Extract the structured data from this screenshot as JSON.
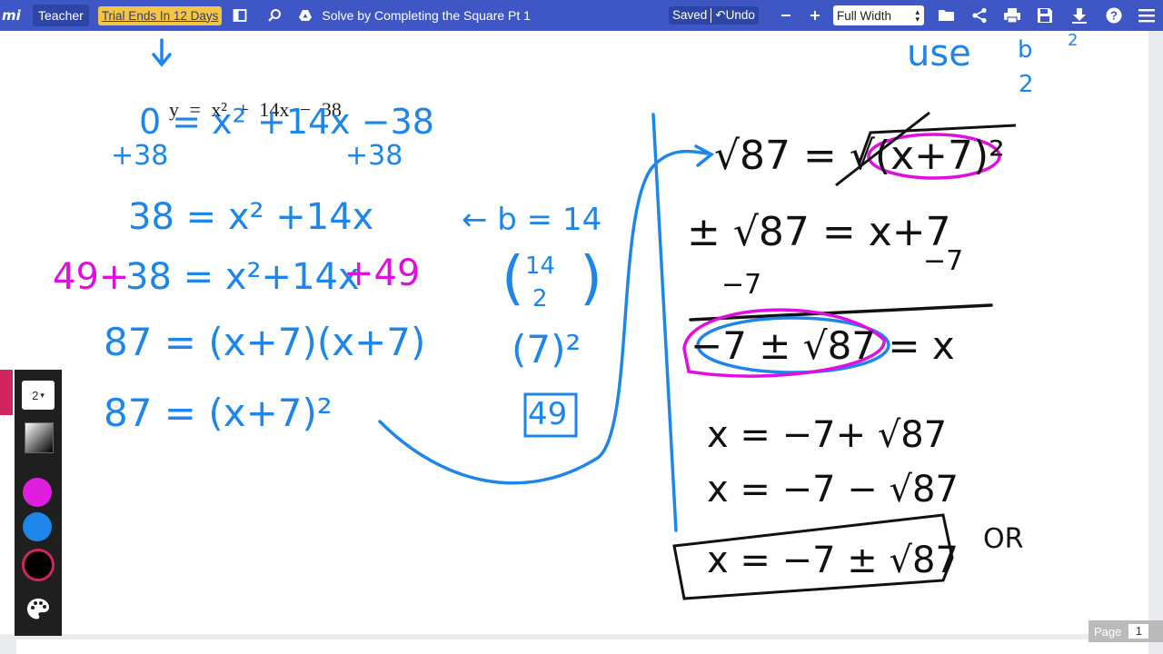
{
  "topbar": {
    "logo": "mi",
    "role": "Teacher",
    "trial": "Trial Ends In 12 Days",
    "title": "Solve by Completing the Square Pt 1",
    "saved": "Saved",
    "undo": "Undo",
    "zoom": "Full Width",
    "icons": [
      "sidebar-icon",
      "search-icon",
      "drive-icon",
      "minus-icon",
      "plus-icon",
      "folder-icon",
      "share-icon",
      "print-icon",
      "save-icon",
      "download-icon",
      "help-icon",
      "menu-icon"
    ]
  },
  "toolbar": {
    "pen_size": "2",
    "colors": [
      "#e01ee0",
      "#1f86e9",
      "#000000"
    ]
  },
  "footer": {
    "page_label": "Page",
    "page_number": "1"
  },
  "notes": {
    "typed_equation": "y = x² + 14x − 38",
    "use": "use",
    "b": "b",
    "two": "2",
    "sq": "2",
    "l1": "0 = x² +14x −38",
    "l1a": "+38",
    "l1b": "+38",
    "l2": "38 = x² +14x",
    "l2b": "← b = 14",
    "l3pre": "49+",
    "l3": "38 = x²+14x",
    "l3post": "+49",
    "f14": "14",
    "f2": "2",
    "l4": "87 = (x+7)(x+7)",
    "p7": "(7)²",
    "l5": "87 = (x+7)²",
    "box49": "49",
    "r1": "√87 = √(x+7)²",
    "r2": "± √87 = x+7",
    "r2a": "−7",
    "r2b": "−7",
    "r3": "−7 ± √87 = x",
    "r4": "x = −7+ √87",
    "r5": "x = −7 − √87",
    "r6": "x = −7 ± √87",
    "or": "OR"
  }
}
